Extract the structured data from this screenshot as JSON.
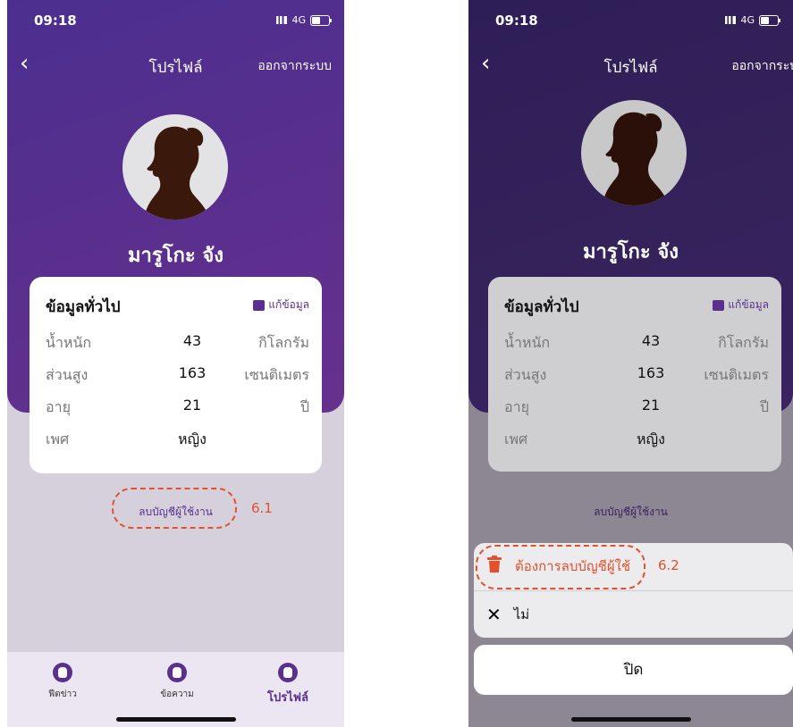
{
  "status": {
    "time": "09:18",
    "network": "4G"
  },
  "nav": {
    "title": "โปรไฟล์",
    "logout": "ออกจากระบบ"
  },
  "profile": {
    "name": "มารูโกะ จัง"
  },
  "card": {
    "title": "ข้อมูลทั่วไป",
    "edit_label": "แก้ข้อมูล",
    "rows": [
      {
        "label": "น้ำหนัก",
        "value": "43",
        "unit": "กิโลกรัม"
      },
      {
        "label": "ส่วนสูง",
        "value": "163",
        "unit": "เซนติเมตร"
      },
      {
        "label": "อายุ",
        "value": "21",
        "unit": "ปี"
      },
      {
        "label": "เพศ",
        "value": "หญิง",
        "unit": ""
      }
    ]
  },
  "delete_account": "ลบบัญชีผู้ใช้งาน",
  "tabs": [
    {
      "label": "ฟีดข่าว"
    },
    {
      "label": "ข้อความ"
    },
    {
      "label": "โปรไฟล์"
    }
  ],
  "sheet": {
    "confirm": "ต้องการลบบัญชีผู้ใช้",
    "cancel": "ไม่",
    "close": "ปิด"
  },
  "annotations": {
    "step1": "6.1",
    "step2": "6.2"
  },
  "colors": {
    "primary": "#5a2f8e",
    "danger": "#e2512c"
  }
}
